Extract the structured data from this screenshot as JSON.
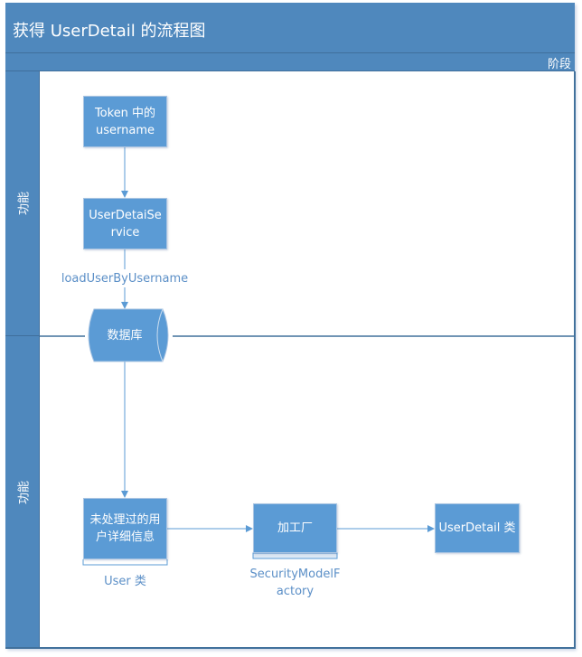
{
  "diagram": {
    "title": "获得 UserDetail 的流程图",
    "phase_label": "阶段",
    "lanes": [
      {
        "label": "功能"
      },
      {
        "label": "功能"
      }
    ],
    "nodes": {
      "token": {
        "label": "Token 中的 username",
        "shape": "process"
      },
      "service": {
        "label": "UserDetaiService",
        "shape": "process"
      },
      "database": {
        "label": "数据库",
        "shape": "cylinder"
      },
      "raw_user": {
        "label": "未处理过的用户详细信息",
        "shape": "process-with-bracket",
        "caption": "User 类"
      },
      "factory": {
        "label": "加工厂",
        "shape": "process-with-bar",
        "caption": "SecurityModelFactory"
      },
      "user_detail": {
        "label": "UserDetail 类",
        "shape": "process"
      }
    },
    "edges": [
      {
        "from": "token",
        "to": "service",
        "label": ""
      },
      {
        "from": "service",
        "to": "database",
        "label": "loadUserByUsername"
      },
      {
        "from": "database",
        "to": "raw_user",
        "label": ""
      },
      {
        "from": "raw_user",
        "to": "factory",
        "label": ""
      },
      {
        "from": "factory",
        "to": "user_detail",
        "label": ""
      }
    ],
    "colors": {
      "header": "#4f88bd",
      "node_fill": "#5b9bd5",
      "connector": "#5b9bd5",
      "caption_text": "#5b8fc7"
    }
  }
}
